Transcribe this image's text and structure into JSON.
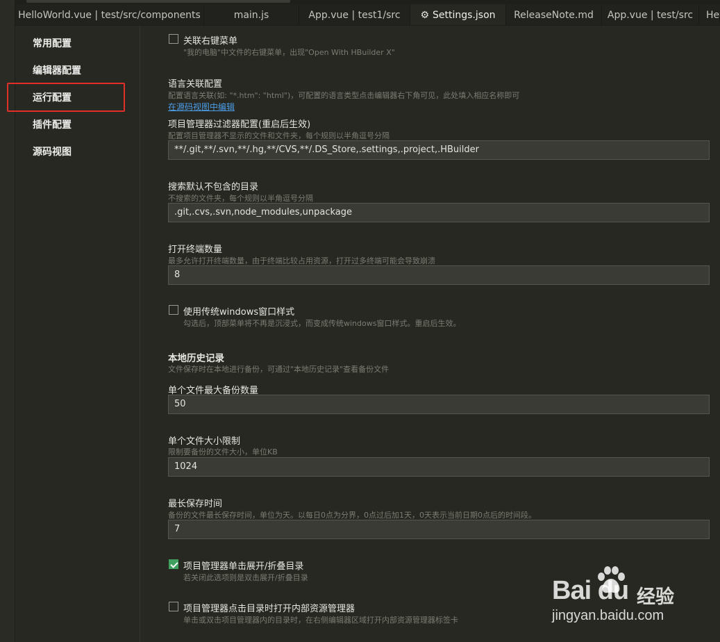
{
  "tabs": [
    {
      "label": "HelloWorld.vue | test/src/components",
      "active": false
    },
    {
      "label": "main.js",
      "active": false
    },
    {
      "label": "App.vue | test1/src",
      "active": false
    },
    {
      "label": "Settings.json",
      "active": true,
      "icon": "gear-icon"
    },
    {
      "label": "ReleaseNote.md",
      "active": false
    },
    {
      "label": "App.vue | test/src",
      "active": false
    },
    {
      "label": "He",
      "active": false
    }
  ],
  "sidebar": {
    "items": [
      {
        "label": "常用配置"
      },
      {
        "label": "编辑器配置"
      },
      {
        "label": "运行配置",
        "highlighted": true
      },
      {
        "label": "插件配置"
      },
      {
        "label": "源码视图"
      }
    ]
  },
  "settings": {
    "context_menu": {
      "label": "关联右键菜单",
      "checked": false,
      "desc": "\"我的电脑\"中文件的右键菜单，出现\"Open With HBuilder X\""
    },
    "lang_assoc": {
      "label": "语言关联配置",
      "desc": "配置语言关联(如: \"*.htm\": \"html\")，可配置的语言类型点击编辑器右下角可见，此处填入相应名称即可",
      "link": "在源码视图中编辑"
    },
    "project_filter": {
      "label": "项目管理器过滤器配置(重启后生效)",
      "desc": "配置项目管理器不显示的文件和文件夹，每个规则以半角逗号分隔",
      "value": "**/.git,**/.svn,**/.hg,**/CVS,**/.DS_Store,.settings,.project,.HBuilder"
    },
    "search_exclude": {
      "label": "搜索默认不包含的目录",
      "desc": "不搜索的文件夹，每个规则以半角逗号分隔",
      "value": ".git,.cvs,.svn,node_modules,unpackage"
    },
    "terminal_count": {
      "label": "打开终端数量",
      "desc": "最多允许打开终端数量，由于终端比较占用资源，打开过多终端可能会导致崩溃",
      "value": "8"
    },
    "win_style": {
      "label": "使用传统windows窗口样式",
      "checked": false,
      "desc": "勾选后，顶部菜单将不再是沉浸式，而变成传统windows窗口样式。重启后生效。"
    },
    "local_history": {
      "label": "本地历史记录",
      "desc": "文件保存时在本地进行备份，可通过\"本地历史记录\"查看备份文件"
    },
    "max_backup": {
      "label": "单个文件最大备份数量",
      "value": "50"
    },
    "file_size": {
      "label": "单个文件大小限制",
      "desc": "限制要备份的文件大小，单位KB",
      "value": "1024"
    },
    "max_time": {
      "label": "最长保存时间",
      "desc": "备份的文件最长保存时间，单位为天。以每日0点为分界，0点过后加1天，0天表示当前日期0点后的时间段。",
      "value": "7"
    },
    "single_click": {
      "label": "项目管理器单击展开/折叠目录",
      "checked": true,
      "desc": "若关闭此选项则是双击展开/折叠目录"
    },
    "open_internal": {
      "label": "项目管理器点击目录时打开内部资源管理器",
      "checked": false,
      "desc": "单击或双击项目管理器内的目录时，在右侧编辑器区域打开内部资源管理器标签卡"
    }
  },
  "watermark": {
    "logo": "Bai  du",
    "text": "经验",
    "url": "jingyan.baidu.com"
  }
}
